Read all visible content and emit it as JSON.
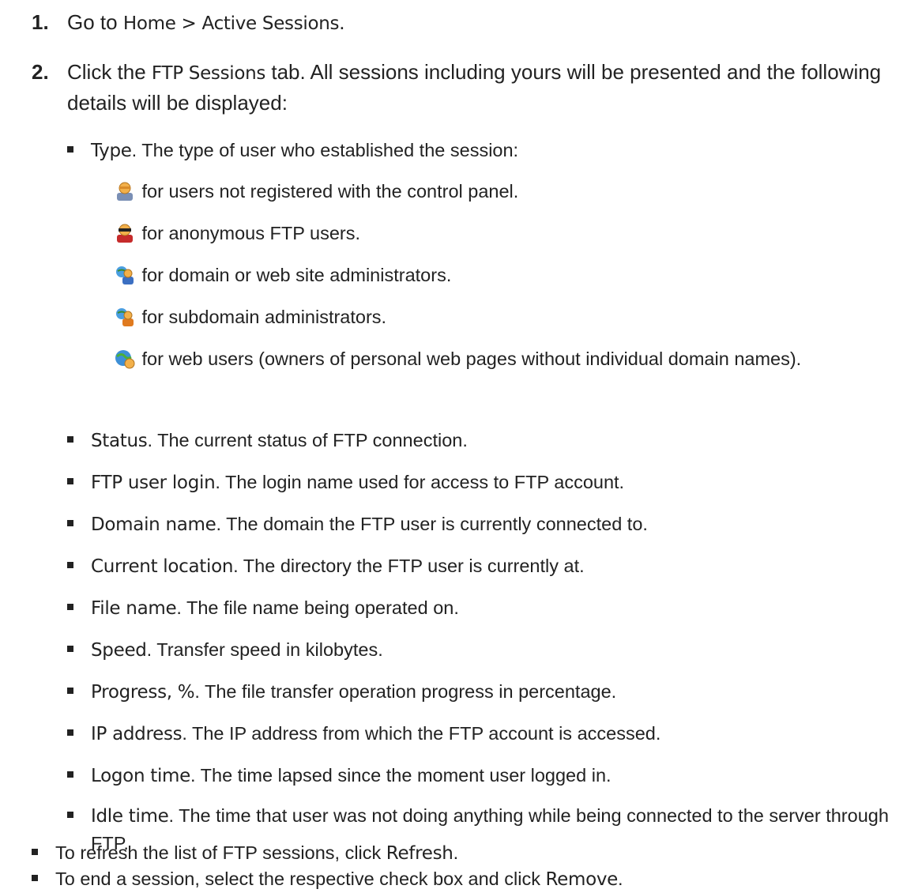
{
  "steps": [
    {
      "num": "1.",
      "pre": "Go to ",
      "ui": "Home > Active Sessions",
      "post": "."
    },
    {
      "num": "2.",
      "pre": "Click the ",
      "ui": "FTP Sessions",
      "post": " tab. All sessions including yours will be presented and the following details will be displayed:"
    }
  ],
  "type_item": {
    "term": "Type",
    "desc": ". The type of user who established the session:"
  },
  "user_types": [
    {
      "icon": "unregistered-user-icon",
      "text": " for users not registered with the control panel."
    },
    {
      "icon": "anonymous-ftp-user-icon",
      "text": " for anonymous FTP users."
    },
    {
      "icon": "domain-admin-icon",
      "text": " for domain or web site administrators."
    },
    {
      "icon": "subdomain-admin-icon",
      "text": " for subdomain administrators."
    },
    {
      "icon": "web-user-icon",
      "text": " for web users (owners of personal web pages without individual domain names)."
    }
  ],
  "details": [
    {
      "term": "Status",
      "desc": ". The current status of FTP connection."
    },
    {
      "term": "FTP user login",
      "desc": ". The login name used for access to FTP account."
    },
    {
      "term": "Domain name",
      "desc": ". The domain the FTP user is currently connected to."
    },
    {
      "term": "Current location",
      "desc": ". The directory the FTP user is currently at."
    },
    {
      "term": "File name",
      "desc": ". The file name being operated on."
    },
    {
      "term": "Speed",
      "desc": ". Transfer speed in kilobytes."
    },
    {
      "term": "Progress, %",
      "desc": ". The file transfer operation progress in percentage."
    },
    {
      "term": "IP address",
      "desc": ". The IP address from which the FTP account is accessed."
    },
    {
      "term": "Logon time",
      "desc": ". The time lapsed since the moment user logged in."
    },
    {
      "term": "Idle time",
      "desc": ". The time that user was not doing anything while being connected to the server through FTP."
    }
  ],
  "actions": [
    {
      "pre": "To refresh the list of FTP sessions, click ",
      "ui": "Refresh",
      "post": "."
    },
    {
      "pre": "To end a session, select the respective check box and click ",
      "ui": "Remove",
      "post": "."
    }
  ]
}
